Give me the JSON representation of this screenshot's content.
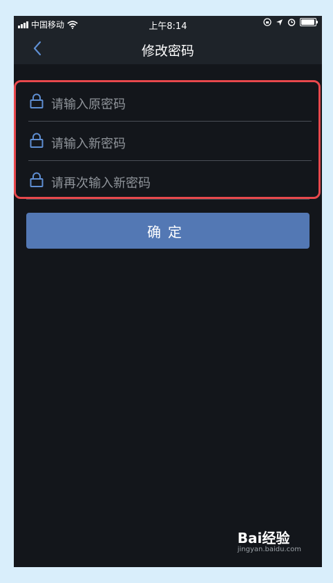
{
  "status_bar": {
    "carrier": "中国移动",
    "time": "上午8:14"
  },
  "nav": {
    "title": "修改密码",
    "back_icon": "chevron-left-icon"
  },
  "form": {
    "fields": [
      {
        "placeholder": "请输入原密码",
        "icon": "lock-icon"
      },
      {
        "placeholder": "请输入新密码",
        "icon": "lock-icon"
      },
      {
        "placeholder": "请再次输入新密码",
        "icon": "lock-icon"
      }
    ],
    "confirm_label": "确定"
  },
  "watermark": {
    "brand": "Bai经验",
    "url": "jingyan.baidu.com"
  },
  "colors": {
    "accent": "#5378b4",
    "highlight_border": "#e8484c",
    "lock_icon": "#5f8fd3",
    "background": "#13161b",
    "bar": "#1e2329"
  }
}
